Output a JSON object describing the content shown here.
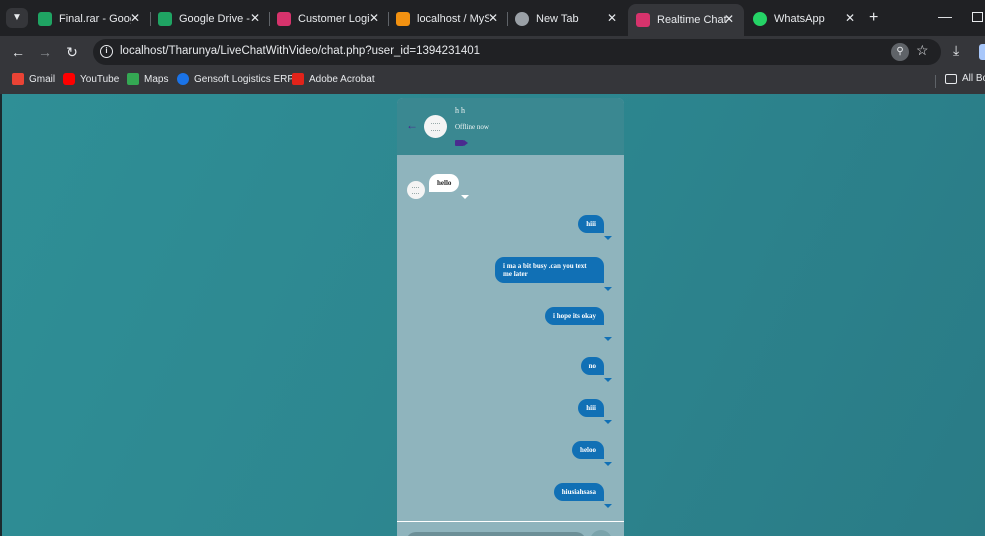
{
  "tabs": [
    {
      "title": "Final.rar - Google",
      "icon": "google-drive-icon",
      "color": "#1fa463"
    },
    {
      "title": "Google Drive - V",
      "icon": "google-drive-icon",
      "color": "#1fa463"
    },
    {
      "title": "Customer Login",
      "icon": "app-favicon-icon",
      "color": "#d6336c"
    },
    {
      "title": "localhost / MySQL",
      "icon": "phpmyadmin-icon",
      "color": "#f29111"
    },
    {
      "title": "New Tab",
      "icon": "chrome-icon",
      "color": "#9aa0a6"
    },
    {
      "title": "Realtime Chat Ap",
      "icon": "app-favicon-icon",
      "color": "#d6336c",
      "active": true
    },
    {
      "title": "WhatsApp",
      "icon": "whatsapp-icon",
      "color": "#25d366"
    }
  ],
  "toolbar": {
    "url": "localhost/Tharunya/LiveChatWithVideo/chat.php?user_id=1394231401"
  },
  "bookmarks": [
    {
      "label": "Gmail",
      "icon": "gmail-icon",
      "color": "#ea4335"
    },
    {
      "label": "YouTube",
      "icon": "youtube-icon",
      "color": "#ff0000"
    },
    {
      "label": "Maps",
      "icon": "maps-icon",
      "color": "#34a853"
    },
    {
      "label": "Gensoft Logistics ERP",
      "icon": "gensoft-icon",
      "color": "#1a73e8"
    },
    {
      "label": "Adobe Acrobat",
      "icon": "acrobat-icon",
      "color": "#e2231a"
    }
  ],
  "all_bookmarks_label": "All Bo",
  "chat": {
    "user_name": "h h",
    "status": "Offline now",
    "messages": [
      {
        "direction": "incoming",
        "text": "hello"
      },
      {
        "direction": "outgoing",
        "text": "hiii"
      },
      {
        "direction": "outgoing",
        "text": "i ma a bit busy .can you text me later"
      },
      {
        "direction": "outgoing",
        "text": "i hope its okay"
      },
      {
        "direction": "outgoing",
        "text": "no"
      },
      {
        "direction": "outgoing",
        "text": "hiii"
      },
      {
        "direction": "outgoing",
        "text": "heloo"
      },
      {
        "direction": "outgoing",
        "text": "hiusiahsasa"
      }
    ]
  },
  "colors": {
    "page_background": "#2d8790",
    "chat_header": "#3a8891",
    "chat_body": "#8fb4bd",
    "outgoing_bubble": "#1170b5",
    "incoming_bubble": "#ffffff"
  }
}
